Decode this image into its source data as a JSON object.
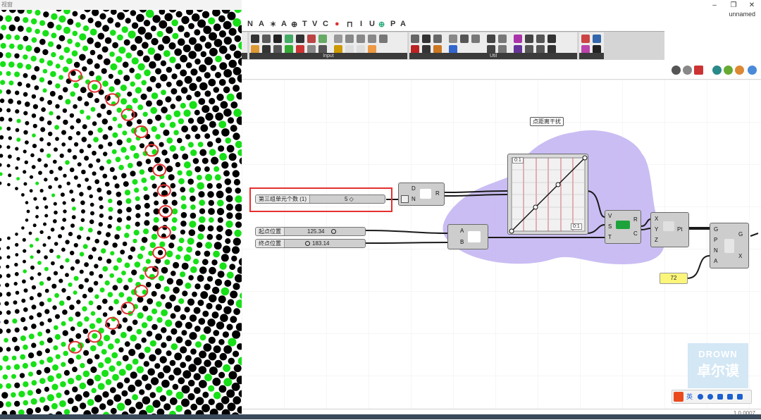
{
  "viewport": {
    "title": "视窗"
  },
  "window": {
    "doc_name": "unnamed",
    "minimize": "–",
    "restore": "❐",
    "close": "✕"
  },
  "tabs": [
    "N",
    "A",
    "✶",
    "A",
    "⊕",
    "T",
    "V",
    "C",
    "●",
    "⊓",
    "I",
    "U",
    "⊕",
    "P",
    "A"
  ],
  "ribbon": {
    "panels": [
      "Input",
      "Util"
    ]
  },
  "canvas": {
    "group_label": "点距离干扰",
    "slider_count": {
      "name": "第三组单元个数 (1)",
      "value": "5 ◇"
    },
    "slider_start": {
      "name": "起点位置",
      "value": "125.34"
    },
    "slider_end": {
      "name": "终点位置",
      "value": "183.14"
    },
    "divide": {
      "in_d": "D",
      "in_n": "N",
      "out_r": "R"
    },
    "bounds": {
      "in_a": "A",
      "in_b": "B"
    },
    "graph": {
      "label_tl": "0:1",
      "label_br": "0:1"
    },
    "remap": {
      "in_v": "V",
      "in_s": "S",
      "in_t": "T",
      "out_r": "R",
      "out_c": "C"
    },
    "point": {
      "in_x": "X",
      "in_y": "Y",
      "in_z": "Z",
      "out_pt": "Pt"
    },
    "pop": {
      "in_g": "G",
      "in_p": "P",
      "in_n": "N",
      "in_a": "A",
      "out_g": "G",
      "out_x": "X"
    },
    "panel_value": "72"
  },
  "watermark": {
    "line1": "DROWN",
    "line2": "卓尔谟"
  },
  "tray": {
    "ime": "英"
  },
  "status": {
    "version": "1.0.0007"
  }
}
